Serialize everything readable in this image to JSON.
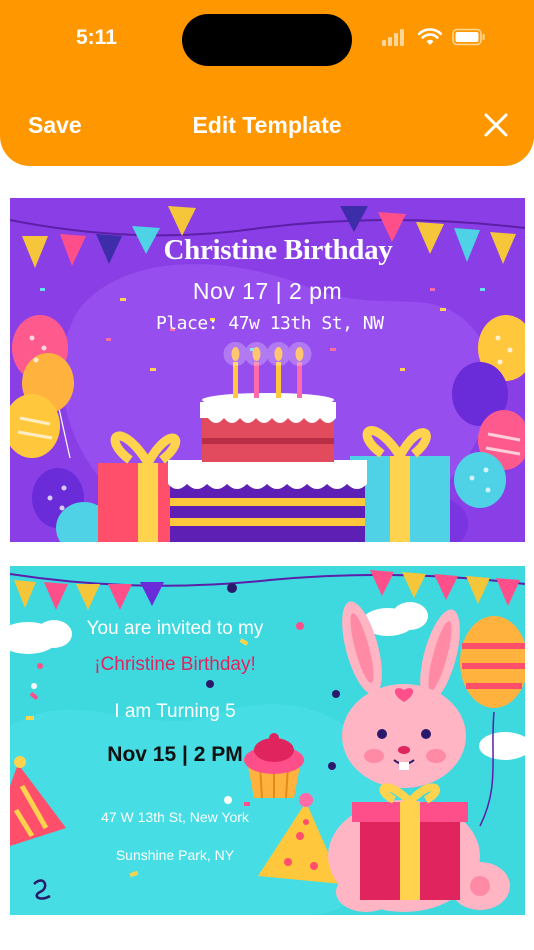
{
  "status_bar": {
    "time": "5:11"
  },
  "nav": {
    "save_label": "Save",
    "title": "Edit Template",
    "close_icon": "close-icon"
  },
  "colors": {
    "header": "#FF9800",
    "card1_bg": "#8A3FE6",
    "card2_bg": "#3ED8DF",
    "accent_pink": "#E0245E"
  },
  "templates": [
    {
      "title": "Christine Birthday",
      "date": "Nov 17 | 2 pm",
      "place": "Place: 47w 13th St, NW"
    },
    {
      "invited": "You are invited to my",
      "name": "¡Christine Birthday!",
      "turning": "I am Turning 5",
      "date": "Nov 15 | 2 PM",
      "address": "47 W 13th St, New York",
      "park": "Sunshine Park, NY"
    }
  ]
}
